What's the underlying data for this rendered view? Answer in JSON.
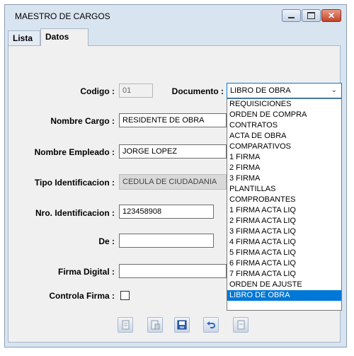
{
  "window": {
    "title": "MAESTRO DE CARGOS"
  },
  "tabs": [
    {
      "label": "Lista"
    },
    {
      "label": "Datos"
    }
  ],
  "form": {
    "codigo": {
      "label": "Codigo :",
      "value": "01"
    },
    "documento": {
      "label": "Documento :",
      "value": "LIBRO DE OBRA",
      "options": [
        "REQUISICIONES",
        "ORDEN DE COMPRA",
        "CONTRATOS",
        "ACTA DE OBRA",
        "COMPARATIVOS",
        "1 FIRMA",
        "2 FIRMA",
        "3 FIRMA",
        "PLANTILLAS",
        "COMPROBANTES",
        "1 FIRMA ACTA LIQ",
        "2 FIRMA ACTA LIQ",
        "3 FIRMA ACTA LIQ",
        "4 FIRMA ACTA LIQ",
        "5 FIRMA ACTA LIQ",
        "6 FIRMA ACTA LIQ",
        "7 FIRMA ACTA LIQ",
        "ORDEN DE AJUSTE",
        "LIBRO DE OBRA"
      ],
      "selected_option": "LIBRO DE OBRA"
    },
    "nombre_cargo": {
      "label": "Nombre Cargo :",
      "value": "RESIDENTE DE OBRA"
    },
    "nombre_empleado": {
      "label": "Nombre Empleado :",
      "value": "JORGE LOPEZ"
    },
    "tipo_identificacion": {
      "label": "Tipo Identificacion :",
      "value": "CEDULA DE CIUDADANIA"
    },
    "nro_identificacion": {
      "label": "Nro. Identificacion :",
      "value": "123458908"
    },
    "de": {
      "label": "De :",
      "value": ""
    },
    "firma_digital": {
      "label": "Firma Digital :",
      "value": ""
    },
    "controla_firma": {
      "label": "Controla Firma :",
      "checked": false
    }
  },
  "toolbar": {
    "buttons": [
      "new-doc-icon",
      "edit-doc-icon",
      "save-icon",
      "undo-icon",
      "delete-doc-icon"
    ]
  },
  "colors": {
    "accent": "#0078d7",
    "window_bg": "#d9e4f1",
    "close_red": "#c2432a"
  }
}
